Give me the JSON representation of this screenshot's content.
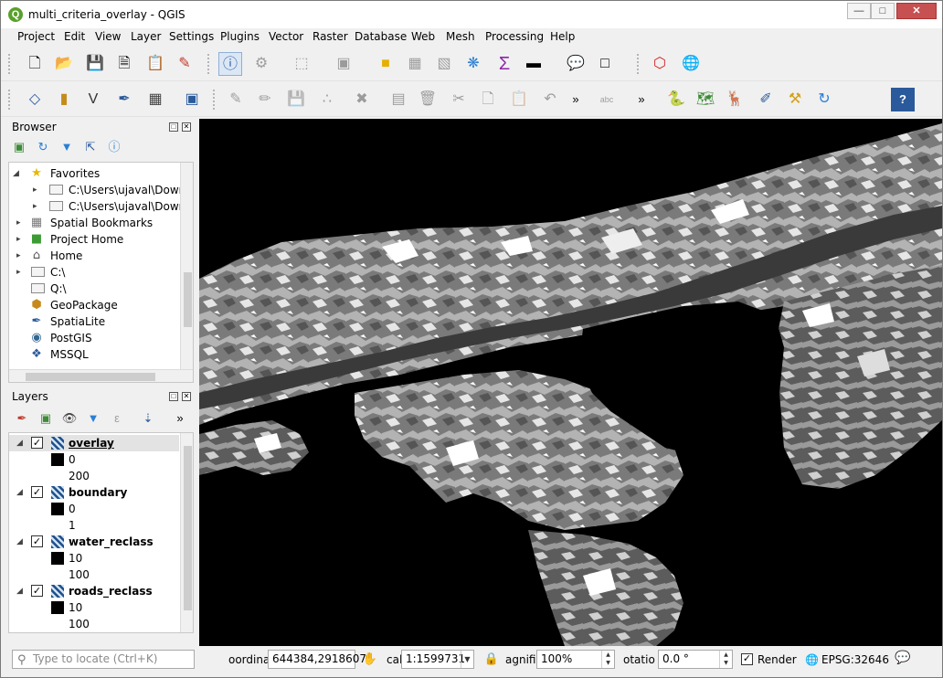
{
  "window": {
    "title": "multi_criteria_overlay - QGIS",
    "app_icon": "qgis-logo-icon"
  },
  "menu": [
    "Project",
    "Edit",
    "View",
    "Layer",
    "Settings",
    "Plugins",
    "Vector",
    "Raster",
    "Database",
    "Web",
    "Mesh",
    "Processing",
    "Help"
  ],
  "toolbar_overflow": "»",
  "browser": {
    "title": "Browser",
    "items": [
      {
        "label": "Favorites",
        "icon": "star-icon",
        "expanded": true
      },
      {
        "label": "C:\\Users\\ujaval\\Downlo",
        "icon": "folder-icon"
      },
      {
        "label": "C:\\Users\\ujaval\\Downlo",
        "icon": "folder-icon"
      },
      {
        "label": "Spatial Bookmarks",
        "icon": "bookmark-icon"
      },
      {
        "label": "Project Home",
        "icon": "project-home-icon"
      },
      {
        "label": "Home",
        "icon": "home-icon"
      },
      {
        "label": "C:\\",
        "icon": "folder-icon"
      },
      {
        "label": "Q:\\",
        "icon": "folder-icon"
      },
      {
        "label": "GeoPackage",
        "icon": "geopackage-icon"
      },
      {
        "label": "SpatiaLite",
        "icon": "spatialite-icon"
      },
      {
        "label": "PostGIS",
        "icon": "postgis-icon"
      },
      {
        "label": "MSSQL",
        "icon": "mssql-icon"
      }
    ]
  },
  "layers": {
    "title": "Layers",
    "items": [
      {
        "name": "overlay",
        "checked": true,
        "min": "0",
        "max": "200",
        "selected": true
      },
      {
        "name": "boundary",
        "checked": true,
        "min": "0",
        "max": "1"
      },
      {
        "name": "water_reclass",
        "checked": true,
        "min": "10",
        "max": "100"
      },
      {
        "name": "roads_reclass",
        "checked": true,
        "min": "10",
        "max": "100"
      }
    ]
  },
  "status": {
    "locate_placeholder": "Type to locate (Ctrl+K)",
    "coordinate_label": "oordinat",
    "coordinate_value": "644384,2918607",
    "scale_label": "cal",
    "scale_value": "1:1599731",
    "magnifier_label": "agnifie",
    "magnifier_value": "100%",
    "rotation_label": "otatio",
    "rotation_value": "0.0 °",
    "render_label": "Render",
    "render_checked": true,
    "crs": "EPSG:32646"
  },
  "colors": {
    "accent": "#5aa02c",
    "close": "#c75050"
  }
}
